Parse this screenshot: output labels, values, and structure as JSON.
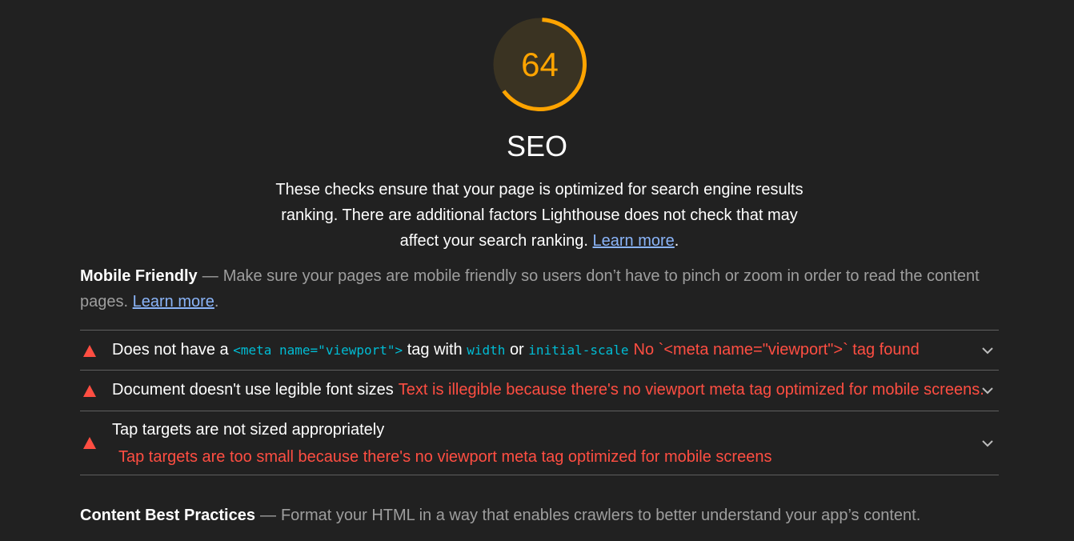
{
  "gauge": {
    "score": "64",
    "fraction": 0.64,
    "color": "#ffa400"
  },
  "category": {
    "title": "SEO",
    "description": "These checks ensure that your page is optimized for search engine results ranking. There are additional factors Lighthouse does not check that may affect your search ranking.",
    "learn_more": "Learn more",
    "period": "."
  },
  "groups": {
    "mobile": {
      "title": "Mobile Friendly",
      "sep": "—",
      "description": "Make sure your pages are mobile friendly so users don’t have to pinch or zoom in order to read the content pages.",
      "learn_more": "Learn more",
      "period": "."
    },
    "content": {
      "title": "Content Best Practices",
      "sep": "—",
      "description": "Format your HTML in a way that enables crawlers to better understand your app’s content."
    }
  },
  "audits": [
    {
      "t1": "Does not have a",
      "code1": "<meta name=\"viewport\">",
      "t2": "tag with",
      "code2": "width",
      "t3": "or",
      "code3": "initial-scale",
      "fail": "No `<meta name=\"viewport\">` tag found",
      "icon": "fail-triangle-icon"
    },
    {
      "title": "Document doesn't use legible font sizes",
      "fail": "Text is illegible because there's no viewport meta tag optimized for mobile screens.",
      "icon": "fail-triangle-icon"
    },
    {
      "title": "Tap targets are not sized appropriately",
      "fail": "Tap targets are too small because there's no viewport meta tag optimized for mobile screens",
      "icon": "fail-triangle-icon"
    }
  ],
  "colors": {
    "background": "#212121",
    "fail": "#ff4e42",
    "average": "#ffa400",
    "link": "#8ab4f8",
    "code": "#00bcd4"
  }
}
